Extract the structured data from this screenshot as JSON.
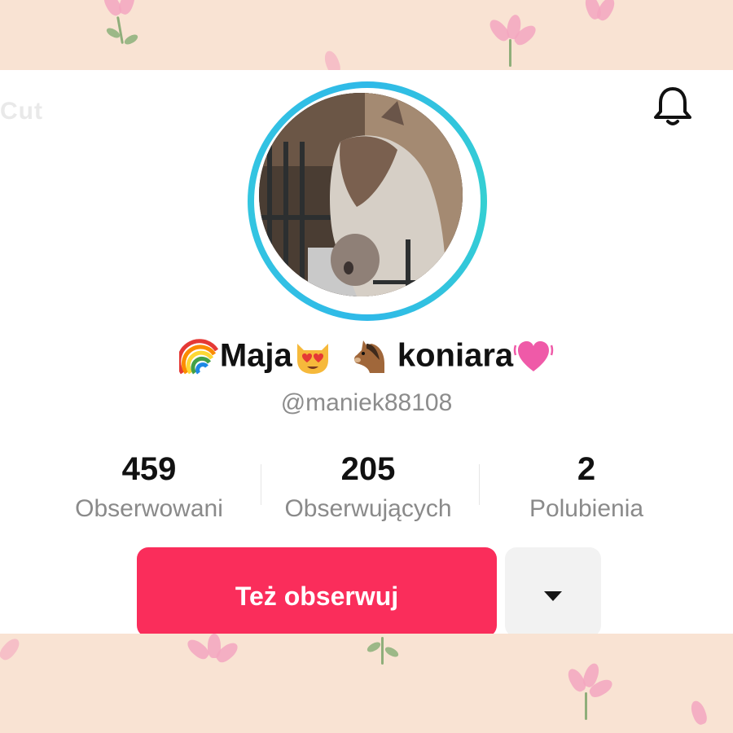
{
  "profile": {
    "display_name_part1": "Maja",
    "display_name_part2": "koniara",
    "username": "@maniek88108",
    "emojis": [
      "rainbow-icon",
      "heart-eyes-cat-icon",
      "horse-icon",
      "pink-vibrating-heart-icon"
    ]
  },
  "stats": [
    {
      "value": "459",
      "label": "Obserwowani"
    },
    {
      "value": "205",
      "label": "Obserwujących"
    },
    {
      "value": "2",
      "label": "Polubienia"
    }
  ],
  "actions": {
    "follow_label": "Też obserwuj"
  },
  "colors": {
    "follow_button": "#fa2d5b",
    "avatar_ring": "#2fb9e8",
    "background": "#f9e3d3"
  }
}
